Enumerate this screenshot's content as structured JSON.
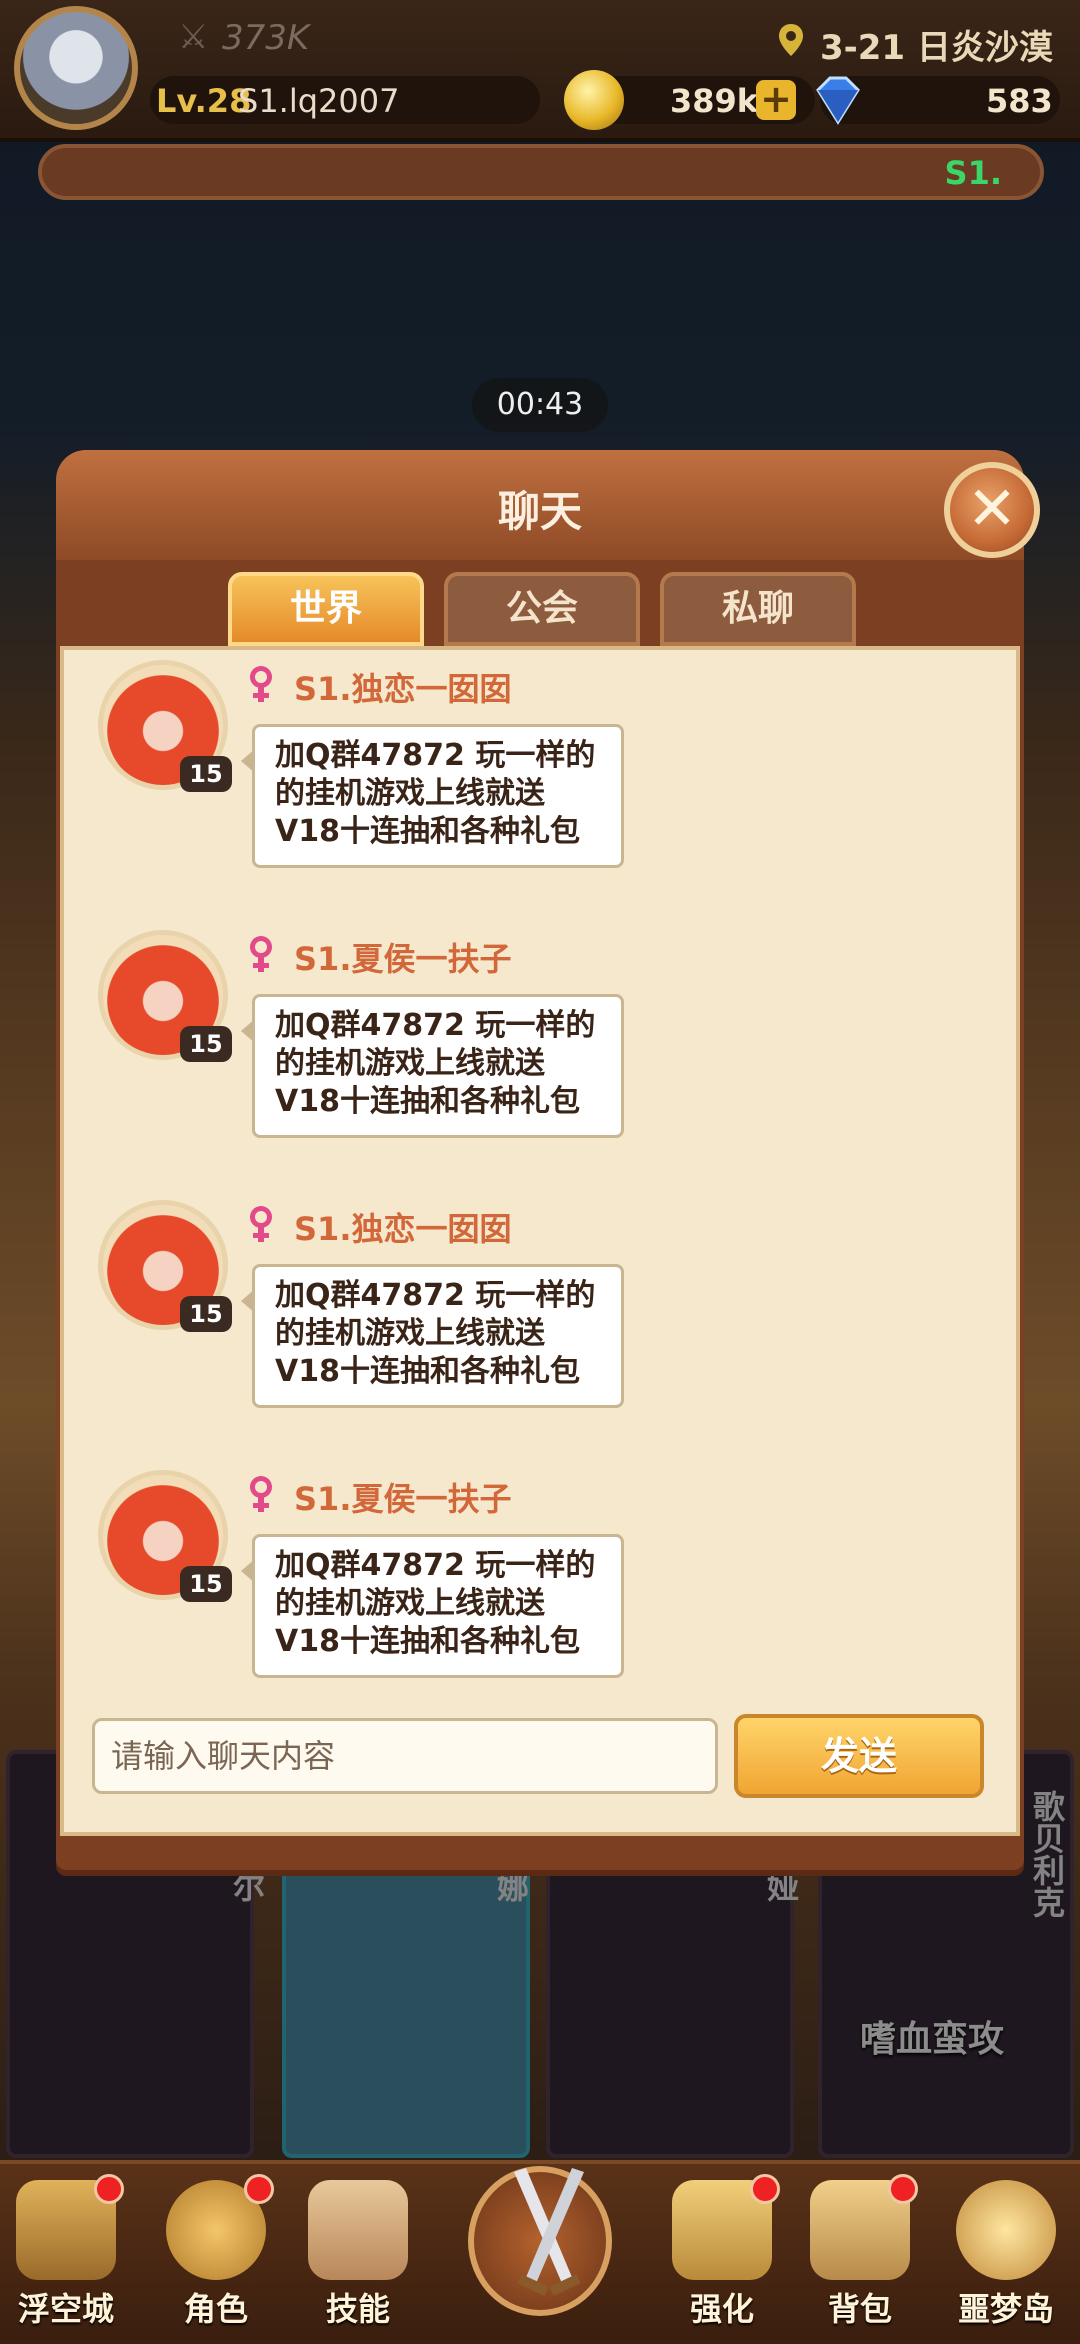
{
  "hud": {
    "power": "373K",
    "level": "Lv.28",
    "username": "S1.lq2007",
    "stage": "3-21 日炎沙漠",
    "gold": "389k",
    "gems": "583"
  },
  "marquee": {
    "text": "S1."
  },
  "timer": "00:43",
  "chat": {
    "title": "聊天",
    "tabs": [
      {
        "label": "世界",
        "active": true
      },
      {
        "label": "公会",
        "active": false
      },
      {
        "label": "私聊",
        "active": false
      }
    ],
    "messages": [
      {
        "sender": "S1.独恋一囡囡",
        "level": "15",
        "text": "加Q群47872 玩一样的\n的挂机游戏上线就送\nV18十连抽和各种礼包"
      },
      {
        "sender": "S1.夏侯一扶子",
        "level": "15",
        "text": "加Q群47872 玩一样的\n的挂机游戏上线就送\nV18十连抽和各种礼包"
      },
      {
        "sender": "S1.独恋一囡囡",
        "level": "15",
        "text": "加Q群47872 玩一样的\n的挂机游戏上线就送\nV18十连抽和各种礼包"
      },
      {
        "sender": "S1.夏侯一扶子",
        "level": "15",
        "text": "加Q群47872 玩一样的\n的挂机游戏上线就送\nV18十连抽和各种礼包"
      }
    ],
    "input_placeholder": "请输入聊天内容",
    "send_label": "发送"
  },
  "heroes": [
    {
      "name": "尔"
    },
    {
      "name": "娜"
    },
    {
      "name": "娅"
    },
    {
      "name": "歌贝利克"
    }
  ],
  "hero_skill_banner": "嗜血蛮攻",
  "nav": [
    {
      "label": "浮空城",
      "dot": true
    },
    {
      "label": "角色",
      "dot": true
    },
    {
      "label": "技能",
      "dot": false
    },
    {
      "label": "强化",
      "dot": true
    },
    {
      "label": "背包",
      "dot": true
    },
    {
      "label": "噩梦岛",
      "dot": false
    }
  ],
  "colors": {
    "accent": "#f0a532",
    "panel": "#7c3f22",
    "parchment": "#f6e8cc",
    "sender": "#d2683a"
  }
}
